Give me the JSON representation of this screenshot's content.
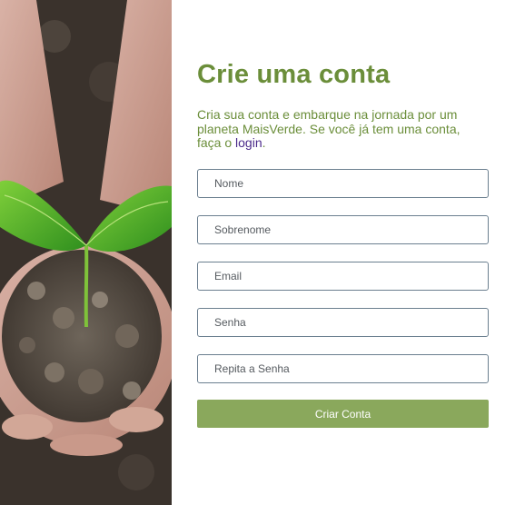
{
  "signup": {
    "title": "Crie uma conta",
    "subtitle_before_link": "Cria sua conta e embarque na jornada por um planeta MaisVerde. Se você já tem uma conta, faça o ",
    "login_link": "login",
    "subtitle_after_link": ".",
    "fields": {
      "first_name_placeholder": "Nome",
      "last_name_placeholder": "Sobrenome",
      "email_placeholder": "Email",
      "password_placeholder": "Senha",
      "confirm_password_placeholder": "Repita a Senha"
    },
    "submit_label": "Criar Conta"
  },
  "colors": {
    "title_green": "#6b8e3a",
    "button_green": "#8aa85c",
    "link_purple": "#4b2a8a",
    "field_border": "#6b7f8f"
  }
}
